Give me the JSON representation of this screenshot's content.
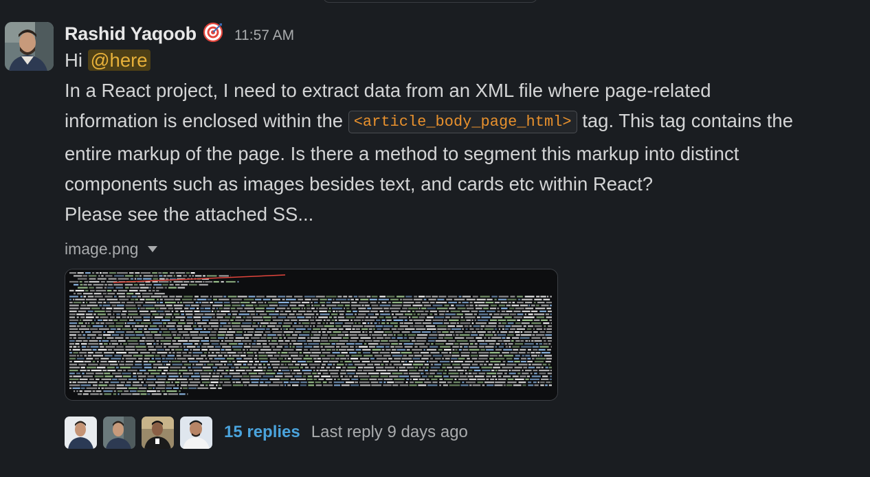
{
  "message": {
    "sender": "Rashid Yaqoob",
    "status_icon": "target-emoji-icon",
    "time": "11:57 AM",
    "greeting": "Hi",
    "mention": "@here",
    "line2": "In a React project, I need to extract data from an XML file where page-related",
    "line3_pre": "information is enclosed within the",
    "code": "<article_body_page_html>",
    "line3_post": "tag. This tag contains the",
    "line4": "entire markup of the page. Is there a method to segment this markup into distinct",
    "line5": "components such as images besides text, and cards etc within React?",
    "line6": "Please see the attached SS..."
  },
  "attachment": {
    "filename": "image.png",
    "dropdown_icon": "caret-down-icon"
  },
  "thread": {
    "replies": "15 replies",
    "last_reply": "Last reply 9 days ago",
    "participants": [
      "participant-1",
      "participant-2",
      "participant-3",
      "participant-4"
    ]
  },
  "colors": {
    "background": "#1a1d21",
    "mention_bg": "#4d3f16",
    "mention_text": "#e8b13a",
    "code_text": "#e8912d",
    "link": "#4aa3dc"
  }
}
